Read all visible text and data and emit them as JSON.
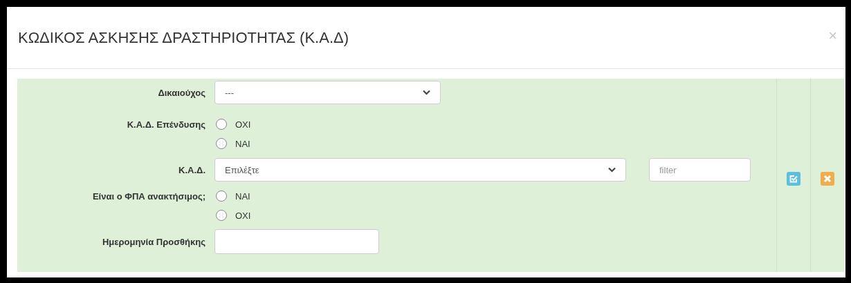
{
  "dialog": {
    "title": "ΚΩΔΙΚΟΣ ΑΣΚΗΣΗΣ ΔΡΑΣΤΗΡΙΟΤΗΤΑΣ (Κ.Α.Δ)",
    "close": "×"
  },
  "form": {
    "fields": [
      {
        "kind": "select",
        "label": "Δικαιούχος",
        "value": "---"
      },
      {
        "kind": "radio",
        "label": "Κ.Α.Δ. Επένδυσης",
        "options": [
          {
            "label": "ΟΧΙ",
            "selected": false
          },
          {
            "label": "ΝΑΙ",
            "selected": false
          }
        ]
      },
      {
        "kind": "select_filter",
        "label": "Κ.Α.Δ.",
        "value": "Επιλέξτε",
        "filter_placeholder": "filter"
      },
      {
        "kind": "radio",
        "label": "Είναι ο ΦΠΑ ανακτήσιμος;",
        "options": [
          {
            "label": "ΝΑΙ",
            "selected": false
          },
          {
            "label": "ΟΧΙ",
            "selected": false
          }
        ]
      },
      {
        "kind": "text",
        "label": "Ημερομηνία Προσθήκης"
      }
    ]
  },
  "actions": [
    {
      "kind": "confirm"
    },
    {
      "kind": "cancel"
    }
  ]
}
